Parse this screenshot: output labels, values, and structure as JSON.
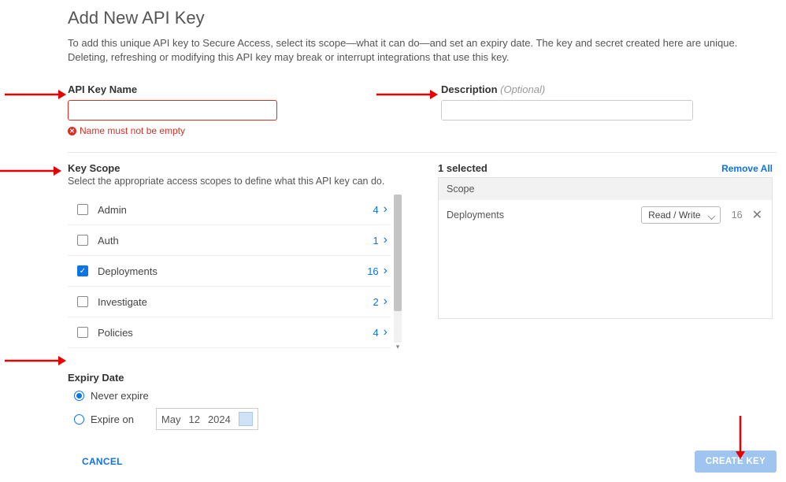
{
  "title": "Add New API Key",
  "intro": "To add this unique API key to Secure Access, select its scope—what it can do—and set an expiry date. The key and secret created here are unique. Deleting, refreshing or modifying this API key may break or interrupt integrations that use this key.",
  "fields": {
    "name_label": "API Key Name",
    "name_value": "",
    "name_error": "Name must not be empty",
    "desc_label": "Description",
    "desc_optional": "(Optional)",
    "desc_value": ""
  },
  "scope": {
    "head": "Key Scope",
    "sub": "Select the appropriate access scopes to define what this API key can do.",
    "items": [
      {
        "name": "Admin",
        "count": 4,
        "checked": false
      },
      {
        "name": "Auth",
        "count": 1,
        "checked": false
      },
      {
        "name": "Deployments",
        "count": 16,
        "checked": true
      },
      {
        "name": "Investigate",
        "count": 2,
        "checked": false
      },
      {
        "name": "Policies",
        "count": 4,
        "checked": false
      }
    ]
  },
  "selected": {
    "count_label": "1 selected",
    "remove_all": "Remove All",
    "header": "Scope",
    "rows": [
      {
        "name": "Deployments",
        "permission": "Read / Write",
        "count": 16
      }
    ]
  },
  "expiry": {
    "head": "Expiry Date",
    "never": "Never expire",
    "expire_on": "Expire on",
    "date_month": "May",
    "date_day": "12",
    "date_year": "2024",
    "selected": "never"
  },
  "footer": {
    "cancel": "CANCEL",
    "create": "CREATE KEY"
  }
}
